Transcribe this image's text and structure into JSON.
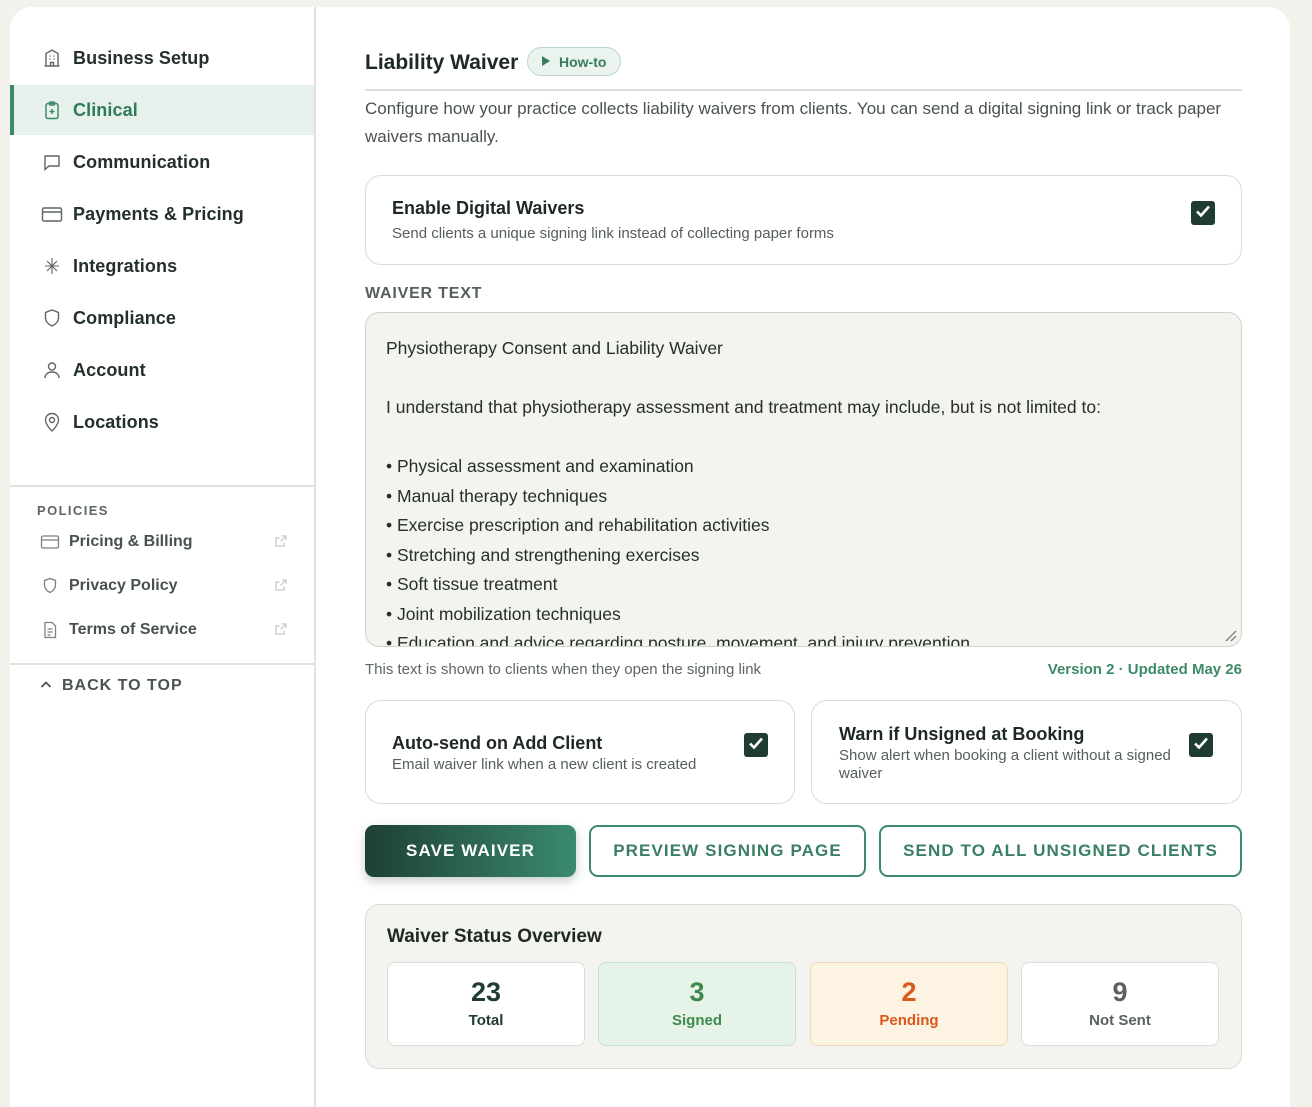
{
  "sidebar": {
    "items": [
      {
        "label": "Business Setup",
        "icon": "building-icon"
      },
      {
        "label": "Clinical",
        "icon": "clipboard-plus-icon",
        "active": true
      },
      {
        "label": "Communication",
        "icon": "chat-bubble-icon"
      },
      {
        "label": "Payments & Pricing",
        "icon": "credit-card-icon"
      },
      {
        "label": "Integrations",
        "icon": "sparkle-icon"
      },
      {
        "label": "Compliance",
        "icon": "shield-icon"
      },
      {
        "label": "Account",
        "icon": "user-icon"
      },
      {
        "label": "Locations",
        "icon": "map-pin-icon"
      }
    ],
    "policies_title": "POLICIES",
    "policies": [
      {
        "label": "Pricing & Billing",
        "icon": "credit-card-icon"
      },
      {
        "label": "Privacy Policy",
        "icon": "shield-icon"
      },
      {
        "label": "Terms of Service",
        "icon": "document-icon"
      }
    ],
    "back_to_top": "BACK TO TOP"
  },
  "main": {
    "title": "Liability Waiver",
    "howto_label": "How-to",
    "description": "Configure how your practice collects liability waivers from clients. You can send a digital signing link or track paper waivers manually.",
    "enable_digital": {
      "title": "Enable Digital Waivers",
      "subtitle": "Send clients a unique signing link instead of collecting paper forms",
      "checked": true
    },
    "waiver_text_label": "WAIVER TEXT",
    "waiver_text": "Physiotherapy Consent and Liability Waiver\n\nI understand that physiotherapy assessment and treatment may include, but is not limited to:\n\n• Physical assessment and examination\n• Manual therapy techniques\n• Exercise prescription and rehabilitation activities\n• Stretching and strengthening exercises\n• Soft tissue treatment\n• Joint mobilization techniques\n• Education and advice regarding posture, movement, and injury prevention",
    "help_text": "This text is shown to clients when they open the signing link",
    "version_text": "Version 2 · Updated May 26",
    "auto_send": {
      "title": "Auto-send on Add Client",
      "subtitle": "Email waiver link when a new client is created",
      "checked": true
    },
    "warn_unsigned": {
      "title": "Warn if Unsigned at Booking",
      "subtitle": "Show alert when booking a client without a signed waiver",
      "checked": true
    },
    "buttons": {
      "save": "SAVE WAIVER",
      "preview": "PREVIEW SIGNING PAGE",
      "send_all": "SEND TO ALL UNSIGNED CLIENTS"
    },
    "overview": {
      "title": "Waiver Status Overview",
      "stats": [
        {
          "value": "23",
          "label": "Total",
          "color": "#1f3b32",
          "bg": "#ffffff",
          "border": "#dcdcd6"
        },
        {
          "value": "3",
          "label": "Signed",
          "color": "#3f8a4a",
          "bg": "#e6f3e9",
          "border": "#c5e2cd"
        },
        {
          "value": "2",
          "label": "Pending",
          "color": "#d9581a",
          "bg": "#fdf3e2",
          "border": "#f2dcb6"
        },
        {
          "value": "9",
          "label": "Not Sent",
          "color": "#5b625e",
          "bg": "#ffffff",
          "border": "#dcdcd6"
        }
      ]
    }
  }
}
